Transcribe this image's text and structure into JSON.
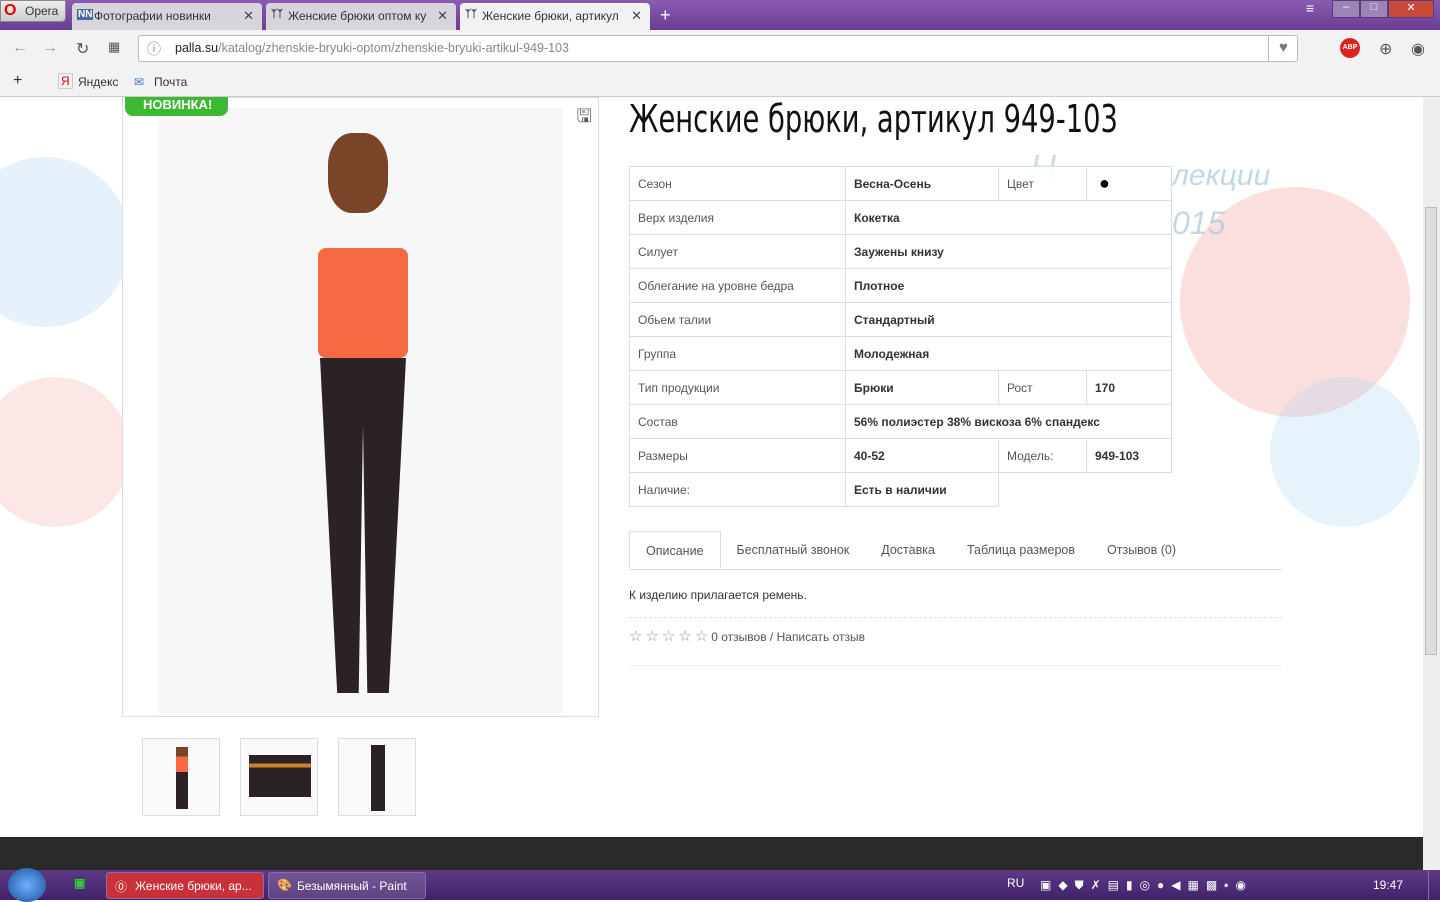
{
  "browser": {
    "menu_label": "Opera",
    "tabs": [
      {
        "icon": "NN",
        "title": "Фотографии новинки"
      },
      {
        "icon": "palla",
        "title": "Женские брюки оптом ку"
      },
      {
        "icon": "palla",
        "title": "Женские брюки, артикул"
      }
    ],
    "url_host": "palla.su",
    "url_path": "/katalog/zhenskie-bryuki-optom/zhenskie-bryuki-artikul-949-103",
    "bookmarks": [
      "Яндекс",
      "Почта"
    ],
    "abp": "ABP"
  },
  "product": {
    "badge": "НОВИНКА!",
    "title": "Женские брюки, артикул 949-103",
    "specs": [
      {
        "label": "Сезон",
        "value": "Весна-Осень",
        "label2": "Цвет",
        "value2": "●"
      },
      {
        "label": "Верх изделия",
        "value": "Кокетка"
      },
      {
        "label": "Силует",
        "value": "Заужены книзу"
      },
      {
        "label": "Облегание на уровне бедра",
        "value": "Плотное"
      },
      {
        "label": "Обьем талии",
        "value": "Стандартный"
      },
      {
        "label": "Группа",
        "value": "Молодежная"
      },
      {
        "label": "Тип продукции",
        "value": "Брюки",
        "label2": "Рост",
        "value2": "170"
      },
      {
        "label": "Состав",
        "value": "56% полиэстер 38% вискоза 6% спандекс"
      },
      {
        "label": "Размеры",
        "value": "40-52",
        "label2": "Модель:",
        "value2": "949-103"
      },
      {
        "label": "Наличие:",
        "value": "Есть в наличии"
      }
    ],
    "tabs": [
      "Описание",
      "Бесплатный звонок",
      "Доставка",
      "Таблица размеров",
      "Отзывов (0)"
    ],
    "description": "К изделию прилагается ремень.",
    "reviews": "0 отзывов / Написать отзыв",
    "bg_text": [
      "Н",
      "лекции",
      "015"
    ]
  },
  "taskbar": {
    "windows": [
      "Женские брюки, ар...",
      "Безымянный - Paint"
    ],
    "lang": "RU",
    "clock": "19:47"
  }
}
